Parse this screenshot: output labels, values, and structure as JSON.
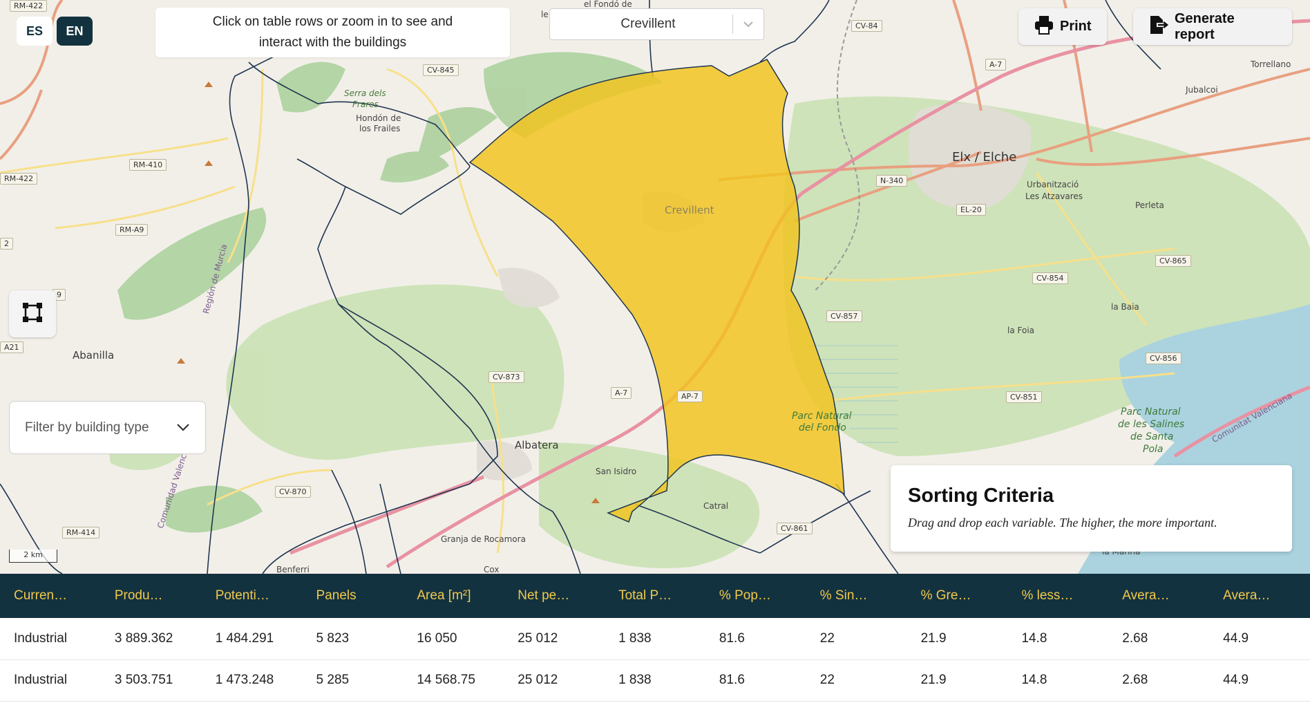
{
  "language": {
    "options": [
      "ES",
      "EN"
    ],
    "active": "EN"
  },
  "hint": {
    "line1": "Click on table rows or zoom in to see and",
    "line2": "interact with the buildings"
  },
  "municipality_select": {
    "value": "Crevillent"
  },
  "toolbar": {
    "print_label": "Print",
    "report_label": "Generate report"
  },
  "filter": {
    "placeholder": "Filter by building type"
  },
  "scale": {
    "label": "2 km"
  },
  "sorting": {
    "title": "Sorting Criteria",
    "subtitle": "Drag and drop each variable. The higher, the more important."
  },
  "map": {
    "places": {
      "elx": "Elx / Elche",
      "crevillent": "Crevillent",
      "albatera": "Albatera",
      "abanilla": "Abanilla",
      "hondon_1": "Hondón de",
      "hondon_2": "los Frailes",
      "serra_1": "Serra dels",
      "serra_2": "Frares",
      "san_isidro": "San Isidro",
      "catral": "Catral",
      "granja": "Granja de Rocamora",
      "cox": "Cox",
      "benferri": "Benferri",
      "atzavares_1": "Urbanització",
      "atzavares_2": "Les Atzavares",
      "perleta": "Perleta",
      "la_baia": "la Baia",
      "la_foia": "la Foia",
      "la_marina": "la Marina",
      "torrellano": "Torrellano",
      "jubalcoi": "Jubalcoi",
      "fondo_top": "el Fondó de",
      "le": "le",
      "parc_fondo_1": "Parc Natural",
      "parc_fondo_2": "del Fondo",
      "salines_1": "Parc Natural",
      "salines_2": "de les Salines",
      "salines_3": "de Santa",
      "salines_4": "Pola",
      "region_murcia": "Región de Murcia",
      "comunitat_v": "Comunitat Valenciana",
      "comunitat_v2": "Comunidad Valenciana"
    },
    "roads": [
      "RM-422",
      "RM-422",
      "RM-410",
      "RM-A9",
      "CV-845",
      "CV-84",
      "A-7",
      "N-340",
      "EL-20",
      "CV-854",
      "CV-865",
      "CV-857",
      "CV-856",
      "CV-851",
      "CV-873",
      "CV-870",
      "CV-861",
      "RM-414",
      "A-7",
      "AP-7",
      "A21",
      "2",
      "9"
    ]
  },
  "table": {
    "headers": [
      "Curren…",
      "Produ…",
      "Potenti…",
      "Panels",
      "Area [m²]",
      "Net pe…",
      "Total P…",
      "% Pop…",
      "% Sin…",
      "% Gre…",
      "% less…",
      "Avera…",
      "Avera…"
    ],
    "rows": [
      [
        "Industrial",
        "3 889.362",
        "1 484.291",
        "5 823",
        "16 050",
        "25 012",
        "1 838",
        "81.6",
        "22",
        "21.9",
        "14.8",
        "2.68",
        "44.9"
      ],
      [
        "Industrial",
        "3 503.751",
        "1 473.248",
        "5 285",
        "14 568.75",
        "25 012",
        "1 838",
        "81.6",
        "22",
        "21.9",
        "14.8",
        "2.68",
        "44.9"
      ]
    ]
  },
  "colors": {
    "selection_fill": "#f2c31c",
    "header_bg": "#13323f",
    "header_text": "#f2c94c"
  }
}
